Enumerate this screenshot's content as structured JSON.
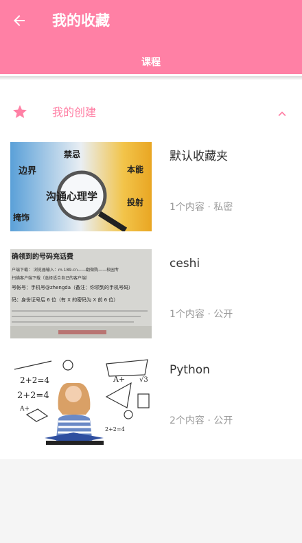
{
  "header": {
    "title": "我的收藏",
    "back_icon": "arrow-left-icon",
    "background": "#ff80a5"
  },
  "tabs": [
    {
      "label": "课程",
      "active": true
    }
  ],
  "section": {
    "icon": "star-icon",
    "label": "我的创建",
    "expanded": true,
    "toggle_icon": "chevron-up-icon",
    "accent": "#ff80a5"
  },
  "items": [
    {
      "name": "默认收藏夹",
      "meta": "1个内容 · 私密",
      "thumb_text": [
        "禁忌",
        "边界",
        "本能",
        "沟通心理学",
        "掩饰",
        "投射"
      ]
    },
    {
      "name": "ceshi",
      "meta": "1个内容 · 公开",
      "thumb_text": [
        "确领到的号码充话费",
        "户端下载： 浏览器输入：m.189.cn——翻微购——校园专",
        "扫描客户端下载（选择适合自己的客户端）",
        "号帐号：手机号@zhengda（备注：你领到的手机号码）",
        "码：身份证号后 6 位（有 X 的密码为 X 前 6 位）"
      ]
    },
    {
      "name": "Python",
      "meta": "2个内容 · 公开",
      "thumb_text": [
        "2+2=4",
        "2+2=4",
        "2+2=4",
        "A+",
        "A+",
        "√3"
      ]
    }
  ]
}
